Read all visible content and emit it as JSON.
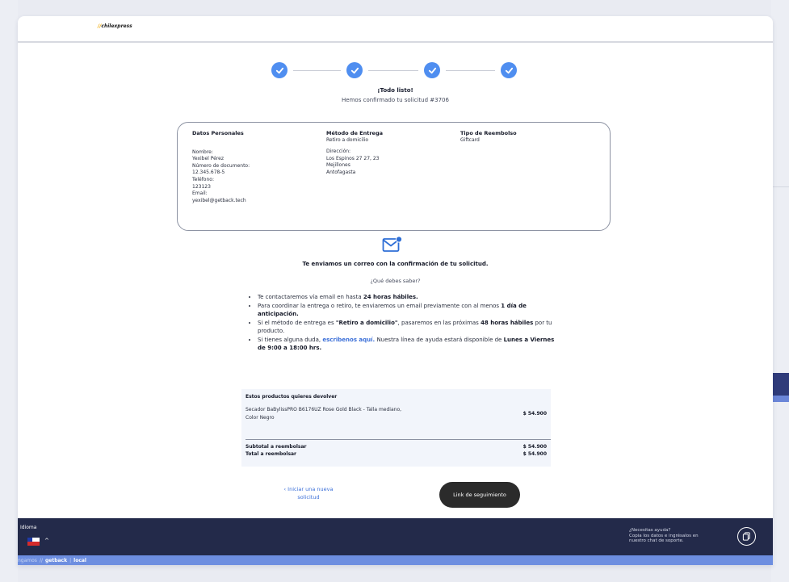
{
  "header": {
    "logo_mark": "//",
    "logo_text": "chilexpress"
  },
  "stepper": {
    "steps": [
      "check",
      "check",
      "check",
      "check"
    ]
  },
  "confirmation": {
    "title": "¡Todo listo!",
    "subtitle": "Hemos confirmado tu solicitud #3706"
  },
  "details": {
    "personal": {
      "heading": "Datos Personales",
      "name_label": "Nombre:",
      "name_value": "Yexibel Pérez",
      "doc_label": "Número de documento:",
      "doc_value": "12.345.678-5",
      "phone_label": "Teléfono:",
      "phone_value": "123123",
      "email_label": "Email:",
      "email_value": "yexibel@getback.tech"
    },
    "delivery": {
      "heading": "Método de Entrega",
      "method": "Retiro a domicilio",
      "address_label": "Dirección:",
      "address_line1": "Los Espinos 27 27, 23",
      "address_line2": "Mejillones",
      "address_line3": "Antofagasta"
    },
    "refund": {
      "heading": "Tipo de Reembolso",
      "type": "Giftcard"
    }
  },
  "email_notice": {
    "title": "Te enviamos un correo con la confirmación de tu solicitud.",
    "know_title": "¿Qué debes saber?"
  },
  "bullets": [
    {
      "pre": "Te contactaremos vía email en hasta ",
      "bold": "24 horas hábiles."
    },
    {
      "pre": "Para coordinar la entrega o retiro, te enviaremos un email previamente con al menos ",
      "bold": "1 día de anticipación."
    },
    {
      "pre": "Si el método de entrega es ",
      "bold": "\"Retiro a domicilio\"",
      "mid": ", pasaremos en las próximas ",
      "bold2": "48 horas hábiles",
      "post": " por tu producto."
    },
    {
      "pre": "Si tienes alguna duda, ",
      "link": "escribenos aquí.",
      "mid": " Nuestra línea de ayuda estará disponible de ",
      "bold": "Lunes a Viernes de 9:00 a 18:00 hrs."
    }
  ],
  "summary": {
    "heading": "Estos productos quieres devolver",
    "product": "Secador BaBylissPRO B6176UZ Rose Gold Black - Talla mediano, Color Negro",
    "product_price": "$ 54.900",
    "subtotal_label": "Subtotal a reembolsar",
    "subtotal_value": "$ 54.900",
    "total_label": "Total a reembolsar",
    "total_value": "$ 54.900"
  },
  "actions": {
    "new_request": "‹ Iniciar una nueva solicitud",
    "tracking": "Link de seguimiento"
  },
  "footer": {
    "language_label": "Idioma",
    "caret": "^",
    "help_line1": "¿Necesitas ayuda?",
    "help_line2": "Copia los datos e ingrésalos en",
    "help_line3": "nuestro chat de soporte."
  },
  "bottombar": {
    "prefix": "ngamos",
    "sep1": "//",
    "brand": "getback",
    "sep2": "|",
    "env": "local"
  },
  "colors": {
    "accent": "#4f8ef0",
    "footer": "#232a4a",
    "link": "#3b6fd8",
    "button": "#2b2b2b"
  }
}
